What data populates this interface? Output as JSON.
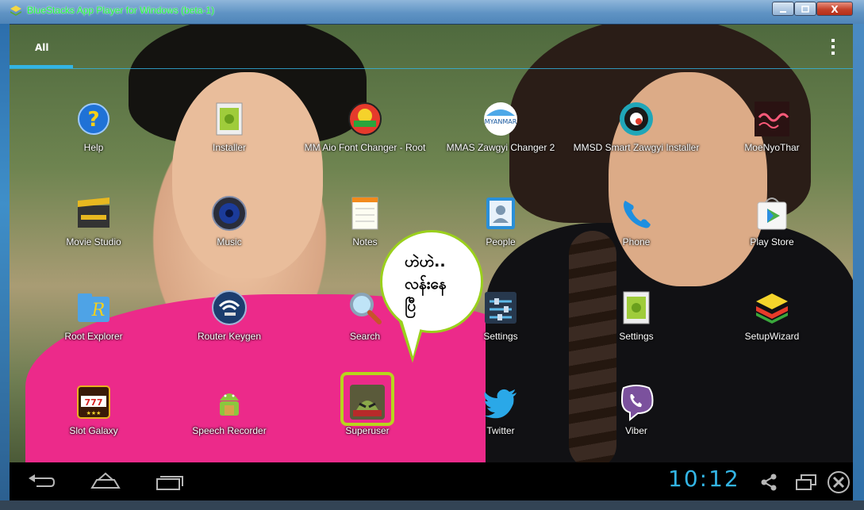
{
  "window": {
    "title": "BlueStacks App Player for Windows (beta-1)",
    "close_symbol": "X"
  },
  "tabs": [
    {
      "label": "All"
    }
  ],
  "apps": [
    {
      "label": "Help",
      "icon": "help-icon"
    },
    {
      "label": "Installer",
      "icon": "installer-icon"
    },
    {
      "label": "MM Aio Font Changer - Root",
      "icon": "mm-aio-font-changer-icon"
    },
    {
      "label": "MMAS Zawgyi Changer 2",
      "icon": "mmas-zawgyi-changer-icon"
    },
    {
      "label": "MMSD Smart Zawgyi Installer",
      "icon": "mmsd-smart-zawgyi-icon"
    },
    {
      "label": "MoeNyoThar",
      "icon": "moenyothar-icon"
    },
    {
      "label": "Movie Studio",
      "icon": "movie-studio-icon"
    },
    {
      "label": "Music",
      "icon": "music-icon"
    },
    {
      "label": "Notes",
      "icon": "notes-icon"
    },
    {
      "label": "People",
      "icon": "people-icon"
    },
    {
      "label": "Phone",
      "icon": "phone-icon"
    },
    {
      "label": "Play Store",
      "icon": "play-store-icon"
    },
    {
      "label": "Root Explorer",
      "icon": "root-explorer-icon"
    },
    {
      "label": "Router Keygen",
      "icon": "router-keygen-icon"
    },
    {
      "label": "Search",
      "icon": "search-icon"
    },
    {
      "label": "Settings",
      "icon": "settings-icon"
    },
    {
      "label": "Settings",
      "icon": "android-settings-icon"
    },
    {
      "label": "SetupWizard",
      "icon": "setup-wizard-icon"
    },
    {
      "label": "Slot Galaxy",
      "icon": "slot-galaxy-icon"
    },
    {
      "label": "Speech Recorder",
      "icon": "speech-recorder-icon"
    },
    {
      "label": "Superuser",
      "icon": "superuser-icon"
    },
    {
      "label": "Twitter",
      "icon": "twitter-icon"
    },
    {
      "label": "Viber",
      "icon": "viber-icon"
    }
  ],
  "bubble": {
    "lines": [
      "ဟဲဟဲ..",
      "လန်းနေ",
      "ပြီ"
    ]
  },
  "navbar": {
    "clock": "10:12"
  },
  "colors": {
    "accent": "#33b5e5",
    "bubble_border": "#9ad01c",
    "title_text": "#23ff3a"
  }
}
